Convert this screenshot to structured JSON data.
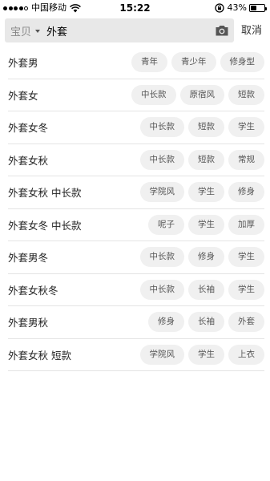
{
  "status_bar": {
    "carrier": "中国移动",
    "time": "15:22",
    "battery_percent": "43%",
    "battery_level": 0.43,
    "signal_bars": 4
  },
  "search": {
    "scope": "宝贝",
    "query": "外套",
    "camera_icon": "camera-icon",
    "cancel_label": "取消"
  },
  "suggestions": [
    {
      "term": "外套男",
      "tags": [
        "青年",
        "青少年",
        "修身型"
      ]
    },
    {
      "term": "外套女",
      "tags": [
        "中长款",
        "原宿风",
        "短款"
      ]
    },
    {
      "term": "外套女冬",
      "tags": [
        "中长款",
        "短款",
        "学生"
      ]
    },
    {
      "term": "外套女秋",
      "tags": [
        "中长款",
        "短款",
        "常规"
      ]
    },
    {
      "term": "外套女秋 中长款",
      "tags": [
        "学院风",
        "学生",
        "修身"
      ]
    },
    {
      "term": "外套女冬 中长款",
      "tags": [
        "呢子",
        "学生",
        "加厚"
      ]
    },
    {
      "term": "外套男冬",
      "tags": [
        "中长款",
        "修身",
        "学生"
      ]
    },
    {
      "term": "外套女秋冬",
      "tags": [
        "中长款",
        "长袖",
        "学生"
      ]
    },
    {
      "term": "外套男秋",
      "tags": [
        "修身",
        "长袖",
        "外套"
      ]
    },
    {
      "term": "外套女秋 短款",
      "tags": [
        "学院风",
        "学生",
        "上衣"
      ]
    }
  ]
}
